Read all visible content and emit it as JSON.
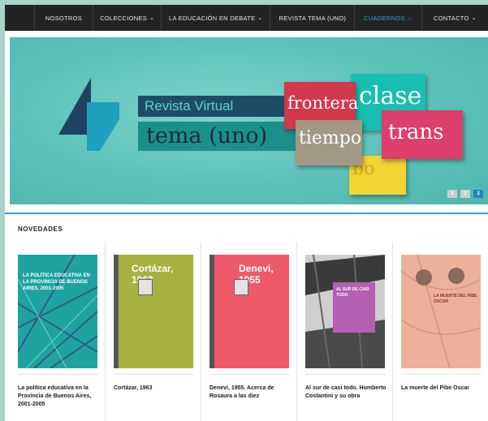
{
  "nav": {
    "items": [
      {
        "label": "NOSOTROS",
        "caret": ""
      },
      {
        "label": "COLECCIONES",
        "caret": "⌄"
      },
      {
        "label": "LA EDUCACIÓN EN DEBATE",
        "caret": "⌄"
      },
      {
        "label": "REVISTA TEMA (UNO)",
        "caret": ""
      },
      {
        "label": "CUADERNOS",
        "caret": "⌄"
      },
      {
        "label": "CONTACTO",
        "caret": "⌄"
      }
    ],
    "active_index": 4
  },
  "banner": {
    "line1": "Revista Virtual",
    "line2": "tema (uno)",
    "cards": [
      "frontera",
      "clase",
      "tiempo",
      "trans",
      "bo"
    ],
    "pager": [
      "1",
      "2",
      "3"
    ],
    "pager_active": 2
  },
  "section_title": "NOVEDADES",
  "books": [
    {
      "title": "La política educativa en la Provincia de Buenos Aires, 2001-2005",
      "cover_title": "LA POLÍTICA EDUCATIVA EN LA PROVINCIA DE BUENOS AIRES, 2001-2005",
      "cover_color": "#1fa3a0"
    },
    {
      "title": "Cortázar, 1963",
      "cover_title": "Cortázar, 1963",
      "cover_color": "#a7b140"
    },
    {
      "title": "Denevi, 1955. Acerca de Rosaura a las diez",
      "cover_title": "Denevi, 1955",
      "cover_color": "#ee5a6a"
    },
    {
      "title": "Al sur de casi todo. Humberto Costantini y su obra",
      "cover_title": "AL SUR DE CASI TODO",
      "cover_color": "#b35fb2"
    },
    {
      "title": "La muerte del Pibe Oscar",
      "cover_title": "LA MUERTE DEL PIBE OSCAR",
      "cover_color": "#e7a58c"
    }
  ]
}
